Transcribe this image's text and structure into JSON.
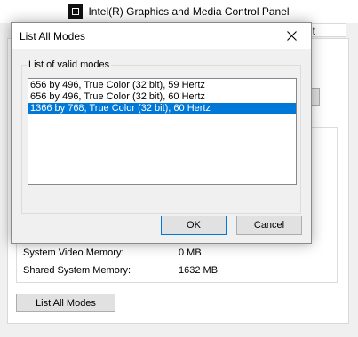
{
  "background": {
    "window_title": "Intel(R) Graphics and Media Control Panel",
    "tab_partial": "nt",
    "rows": [
      {
        "label": "System Video Memory:",
        "value": "0 MB"
      },
      {
        "label": "Shared System Memory:",
        "value": "1632 MB"
      }
    ],
    "list_all_modes_button": "List All Modes"
  },
  "dialog": {
    "title": "List All Modes",
    "group_label": "List of valid modes",
    "modes": [
      {
        "text": "656 by 496, True Color (32 bit), 59 Hertz",
        "selected": false
      },
      {
        "text": "656 by 496, True Color (32 bit), 60 Hertz",
        "selected": false
      },
      {
        "text": "1366 by 768, True Color (32 bit), 60 Hertz",
        "selected": true
      }
    ],
    "ok_label": "OK",
    "cancel_label": "Cancel"
  },
  "icons": {
    "close": "close-icon",
    "app": "intel-graphics-app-icon"
  },
  "colors": {
    "selection": "#0078d7",
    "default_button_border": "#0078d7"
  }
}
